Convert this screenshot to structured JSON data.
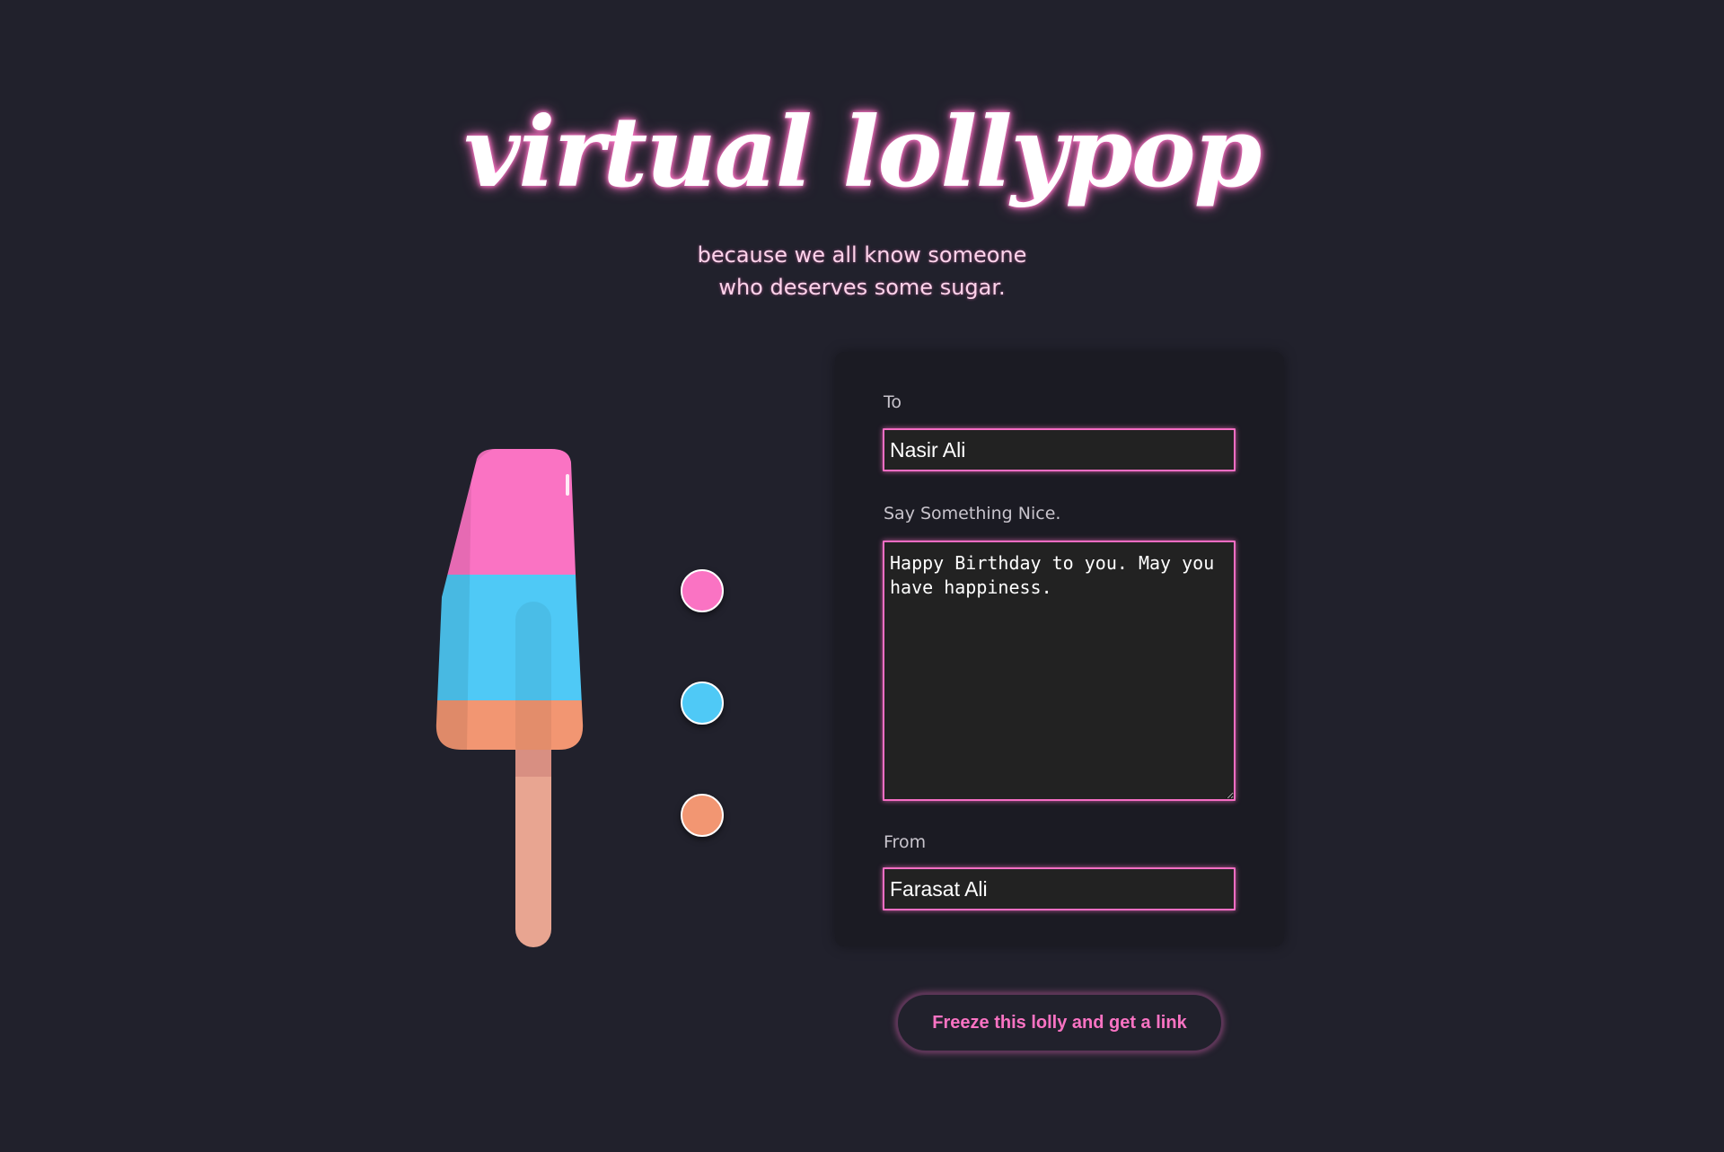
{
  "header": {
    "title": "virtual lollypop",
    "subtitle_line_1": "because we all know someone",
    "subtitle_line_2": "who deserves some sugar."
  },
  "lolly": {
    "colors": {
      "top": "#fa73c3",
      "middle": "#4fc9f6",
      "bottom": "#f29672",
      "stick": "#e8a591"
    },
    "swatches": [
      {
        "name": "top-flavour",
        "color": "#fa73c3"
      },
      {
        "name": "middle-flavour",
        "color": "#4fc9f6"
      },
      {
        "name": "bottom-flavour",
        "color": "#f29672"
      }
    ]
  },
  "form": {
    "to_label": "To",
    "to_value": "Nasir Ali",
    "message_label": "Say Something Nice.",
    "message_value": "Happy Birthday to you. May you have happiness.",
    "from_label": "From",
    "from_value": "Farasat Ali",
    "submit_label": "Freeze this lolly and get a link"
  },
  "theme": {
    "background": "#21212c",
    "panel_background": "#1b1b23",
    "accent": "#f56dc3"
  }
}
